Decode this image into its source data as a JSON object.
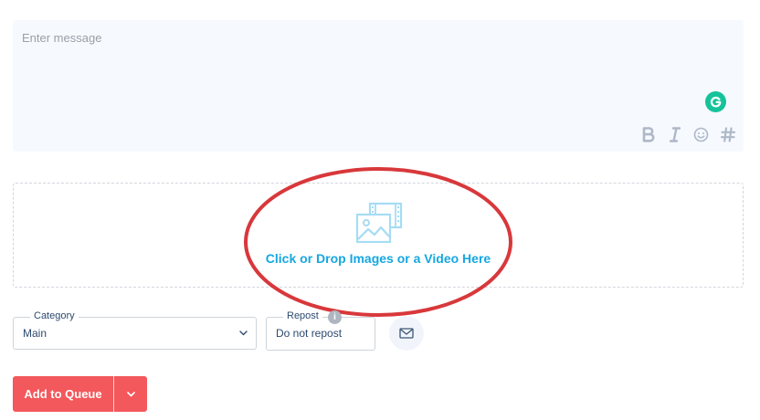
{
  "composer": {
    "placeholder": "Enter message",
    "value": "",
    "toolbar": {
      "bold_icon": "bold-icon",
      "italic_icon": "italic-icon",
      "emoji_icon": "emoji-icon",
      "hashtag_icon": "hashtag-icon"
    },
    "grammarly_icon": "grammarly-icon"
  },
  "dropzone": {
    "label": "Click or Drop Images or a Video Here",
    "icon": "media-upload-icon"
  },
  "category": {
    "label": "Category",
    "value": "Main"
  },
  "repost": {
    "label": "Repost",
    "value": "Do not repost",
    "info_glyph": "i"
  },
  "actions": {
    "add_to_queue": "Add to Queue",
    "email_icon": "envelope-icon",
    "dropdown_icon": "chevron-down-icon"
  },
  "colors": {
    "primary_button": "#f3585c",
    "link_blue": "#16a7e0",
    "grammarly_green": "#15c39a",
    "annotation_red": "#d8383b"
  }
}
